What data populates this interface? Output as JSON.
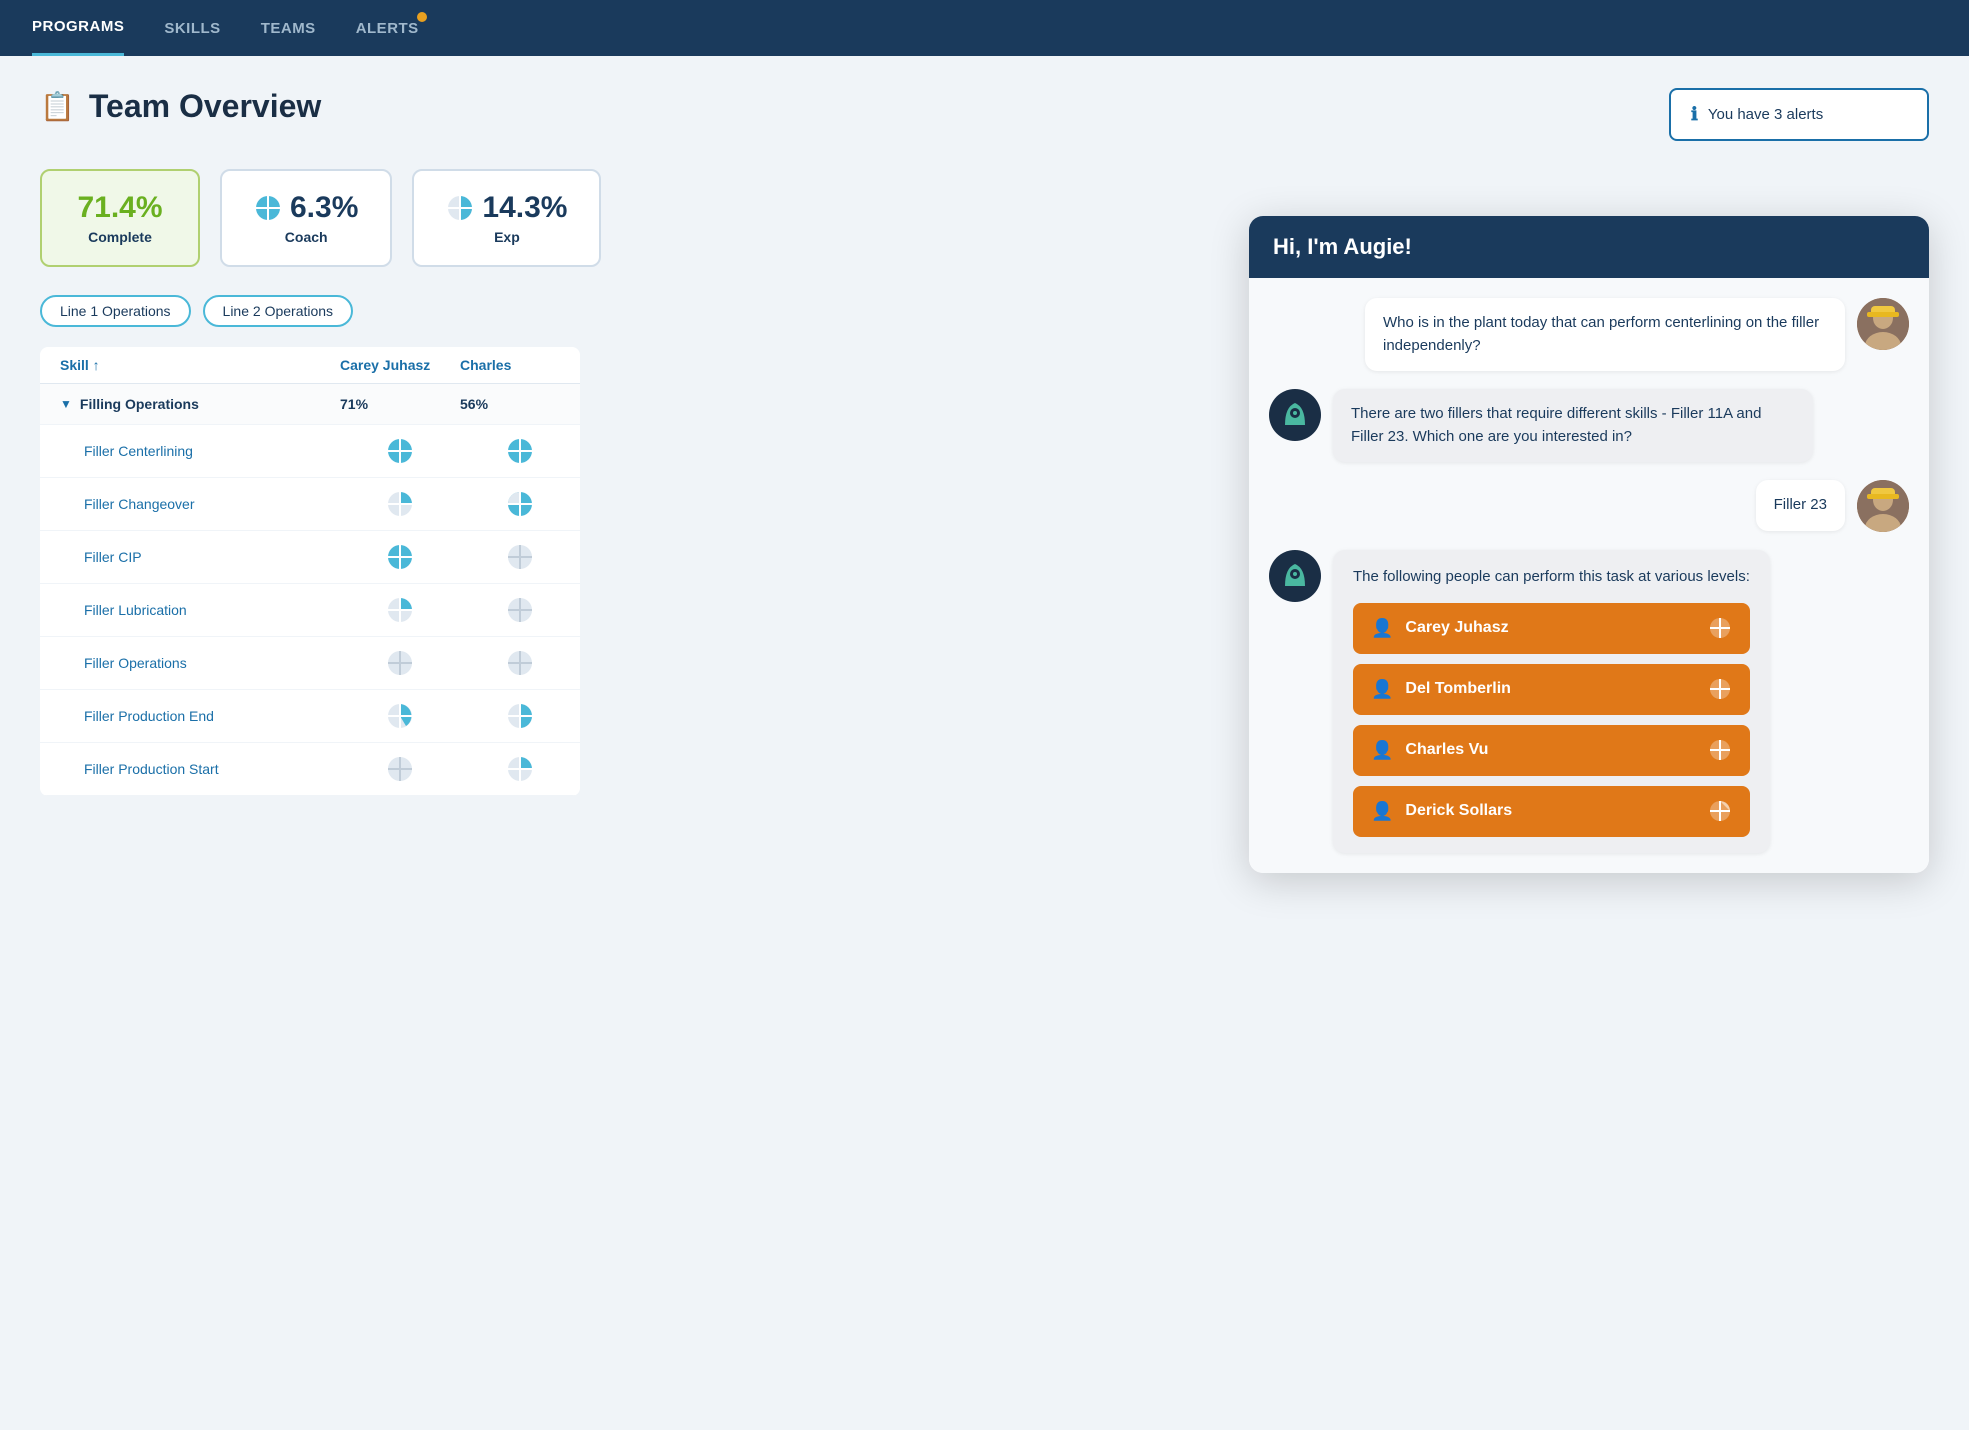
{
  "nav": {
    "items": [
      {
        "label": "PROGRAMS",
        "active": true,
        "alert": false
      },
      {
        "label": "SKILLS",
        "active": false,
        "alert": false
      },
      {
        "label": "TEAMS",
        "active": false,
        "alert": false
      },
      {
        "label": "ALERTS",
        "active": false,
        "alert": true
      }
    ]
  },
  "page": {
    "title": "Team Overview",
    "icon": "📋"
  },
  "alerts_badge": {
    "text": "You have 3 alerts"
  },
  "stats": [
    {
      "value": "71.4%",
      "label": "Complete",
      "highlight": true,
      "has_icon": false
    },
    {
      "value": "6.3%",
      "label": "Coach",
      "highlight": false,
      "has_icon": true,
      "icon_type": "full"
    },
    {
      "value": "14.3%",
      "label": "Exp",
      "highlight": false,
      "has_icon": true,
      "icon_type": "half"
    }
  ],
  "filters": [
    "Line 1 Operations",
    "Line 2 Operations"
  ],
  "table": {
    "columns": [
      "Skill",
      "Carey Juhasz",
      "Charles"
    ],
    "sections": [
      {
        "name": "Filling Operations",
        "pct_col1": "71%",
        "pct_col2": "56%",
        "skills": [
          {
            "name": "Filler Centerlining",
            "col1_level": "full",
            "col2_level": "full"
          },
          {
            "name": "Filler Changeover",
            "col1_level": "quarter",
            "col2_level": "three_quarter"
          },
          {
            "name": "Filler CIP",
            "col1_level": "full",
            "col2_level": "empty"
          },
          {
            "name": "Filler Lubrication",
            "col1_level": "quarter",
            "col2_level": "empty"
          },
          {
            "name": "Filler Operations",
            "col1_level": "empty",
            "col2_level": "empty"
          },
          {
            "name": "Filler Production End",
            "col1_level": "quarter_small",
            "col2_level": "half"
          },
          {
            "name": "Filler Production Start",
            "col1_level": "empty",
            "col2_level": "half"
          }
        ]
      }
    ]
  },
  "chat": {
    "title": "Hi, I'm Augie!",
    "messages": [
      {
        "type": "user",
        "text": "Who is in the plant today that can perform centerlining on the filler independenly?"
      },
      {
        "type": "bot",
        "text": "There are two fillers that require different skills - Filler 11A and Filler 23.  Which one are you interested in?"
      },
      {
        "type": "user",
        "text": "Filler 23"
      },
      {
        "type": "bot_list",
        "intro": "The following people can perform this task at various levels:",
        "people": [
          {
            "name": "Carey Juhasz",
            "icon": "full"
          },
          {
            "name": "Del Tomberlin",
            "icon": "full"
          },
          {
            "name": "Charles Vu",
            "icon": "full"
          },
          {
            "name": "Derick Sollars",
            "icon": "quarter"
          }
        ]
      }
    ]
  }
}
